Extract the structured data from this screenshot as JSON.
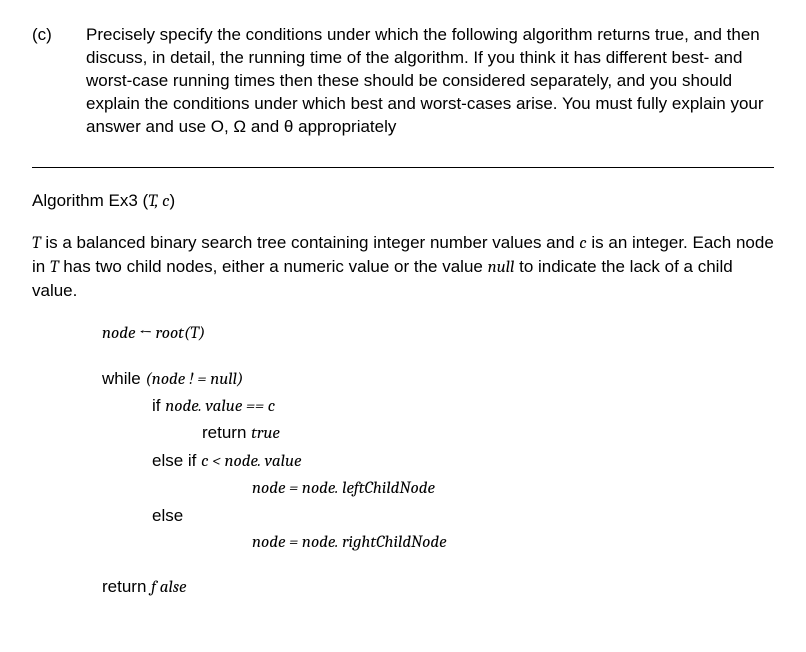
{
  "question": {
    "label": "(c)",
    "text": "Precisely specify the conditions under which the following algorithm returns true, and then discuss, in detail, the running time of the algorithm. If you think it has different best- and worst-case running times then these should be considered separately, and you should explain the conditions under which best and worst-cases arise. You must fully explain your answer and use O, Ω and θ appropriately"
  },
  "algorithm": {
    "title_prefix": "Algorithm Ex3 (",
    "title_args": "T, c",
    "title_suffix": ")",
    "desc_parts": {
      "p1": "T",
      "p2": " is a balanced binary search tree containing integer number values and ",
      "p3": "c",
      "p4": " is an integer. Each node in ",
      "p5": "T",
      "p6": " has two child nodes, either a numeric value or the value ",
      "p7": "null",
      "p8": " to indicate the lack of a child value."
    },
    "lines": {
      "l1_a": "node ← root",
      "l1_b": "(T)",
      "l2_a": "while ",
      "l2_b": "(node ! =  null)",
      "l3_a": "if ",
      "l3_b": "node. value  ==  c",
      "l4_a": "return ",
      "l4_b": "true",
      "l5_a": "else if  ",
      "l5_b": "c < node. value",
      "l6_a": "node  =  node. leftChildNode",
      "l7_a": "else",
      "l8_a": "node  =  node. rightChildNode",
      "l9_a": "return ",
      "l9_b": "f alse"
    }
  }
}
